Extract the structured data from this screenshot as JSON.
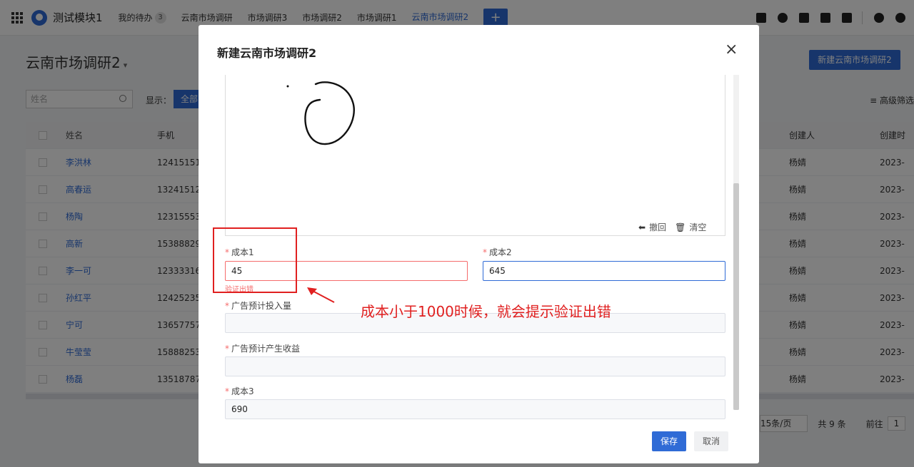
{
  "topbar": {
    "app_title": "测试模块1",
    "tabs": [
      {
        "label": "我的待办",
        "badge": "3"
      },
      {
        "label": "云南市场调研"
      },
      {
        "label": "市场调研3"
      },
      {
        "label": "市场调研2"
      },
      {
        "label": "市场调研1"
      },
      {
        "label": "云南市场调研2"
      }
    ],
    "add_tab_label": "+"
  },
  "page": {
    "title": "云南市场调研2",
    "title_caret": "▾",
    "new_button": "新建云南市场调研2",
    "search_placeholder": "姓名",
    "show_label": "显示：",
    "show_all": "全部",
    "advanced_filter": "≡ 高级筛选"
  },
  "table": {
    "headers": {
      "name": "姓名",
      "phone": "手机",
      "creator": "创建人",
      "date": "创建时"
    },
    "rows": [
      {
        "name": "李洪林",
        "phone": "12415151",
        "creator": "杨婧",
        "date": "2023-"
      },
      {
        "name": "高春运",
        "phone": "13241512",
        "creator": "杨婧",
        "date": "2023-"
      },
      {
        "name": "杨陶",
        "phone": "12315553",
        "creator": "杨婧",
        "date": "2023-"
      },
      {
        "name": "高新",
        "phone": "15388829",
        "creator": "杨婧",
        "date": "2023-"
      },
      {
        "name": "李一可",
        "phone": "12333316",
        "creator": "杨婧",
        "date": "2023-"
      },
      {
        "name": "孙红平",
        "phone": "12425235",
        "creator": "杨婧",
        "date": "2023-"
      },
      {
        "name": "宁可",
        "phone": "13657757",
        "creator": "杨婧",
        "date": "2023-"
      },
      {
        "name": "牛莹莹",
        "phone": "15888253",
        "creator": "杨婧",
        "date": "2023-"
      },
      {
        "name": "杨磊",
        "phone": "13518787",
        "creator": "杨婧",
        "date": "2023-"
      }
    ]
  },
  "pager": {
    "page_size": "15条/页",
    "total": "共 9 条",
    "goto_label": "前往",
    "page": "1"
  },
  "modal": {
    "title": "新建云南市场调研2",
    "close": "×",
    "sign_undo": "撤回",
    "sign_clear": "清空",
    "fields": {
      "cost1": {
        "label": "成本1",
        "value": "45",
        "error": "验证出错"
      },
      "cost2": {
        "label": "成本2",
        "value": "645"
      },
      "ad_invest": {
        "label": "广告预计投入量",
        "value": ""
      },
      "ad_revenue": {
        "label": "广告预计产生收益",
        "value": ""
      },
      "cost3": {
        "label": "成本3",
        "value": "690"
      }
    },
    "required_mark": "*",
    "save": "保存",
    "cancel": "取消"
  },
  "annotation": {
    "text": "成本小于1000时候，就会提示验证出错",
    "color": "#e02020"
  },
  "colors": {
    "accent": "#2f6bd6",
    "error": "#f56c6c"
  }
}
